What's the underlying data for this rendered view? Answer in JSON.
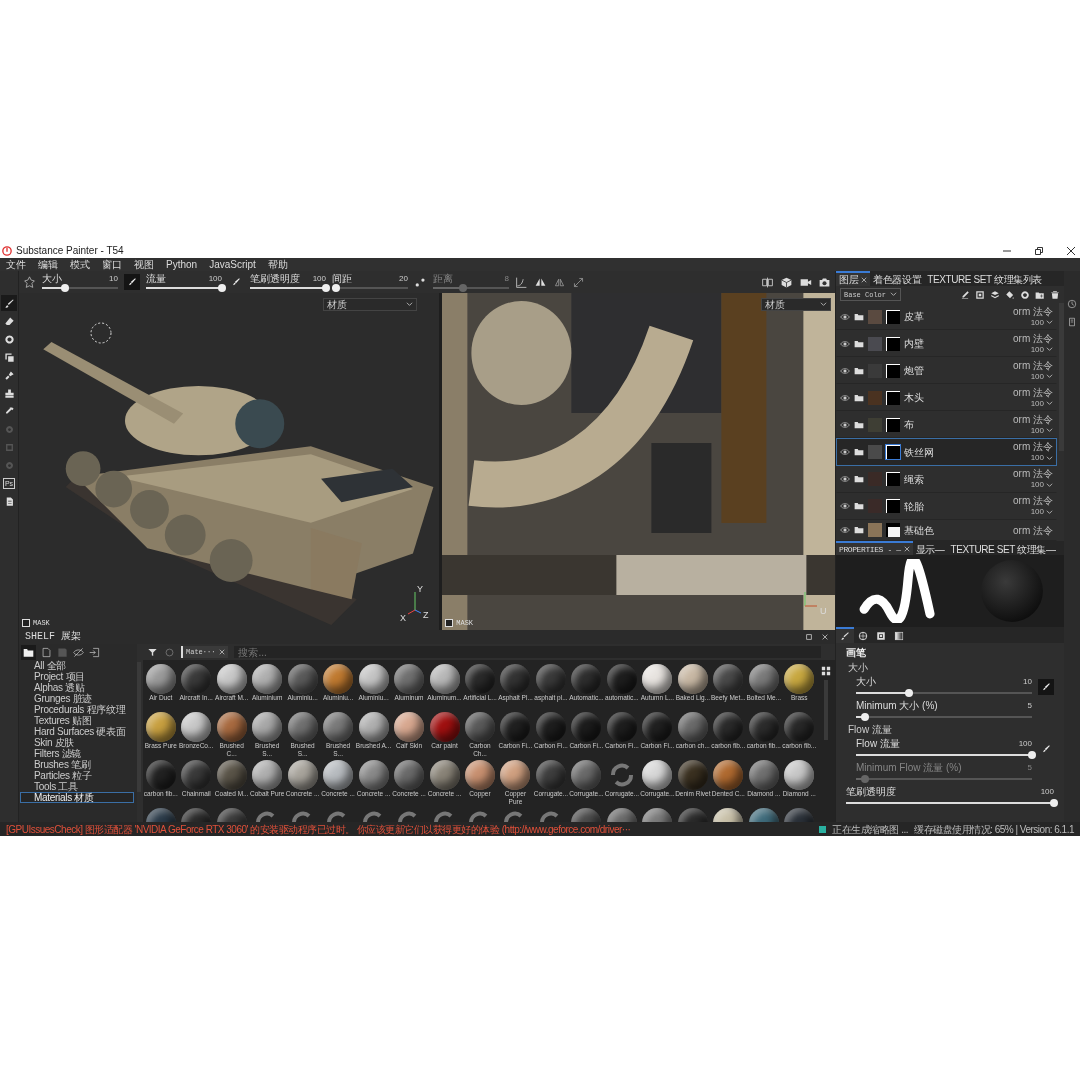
{
  "window": {
    "title": "Substance Painter - T54"
  },
  "menu": [
    "文件",
    "编辑",
    "模式",
    "窗口",
    "视图",
    "Python",
    "JavaScript",
    "帮助"
  ],
  "tools": [
    {
      "selected": true,
      "disabled": false
    },
    {
      "selected": false,
      "disabled": false
    },
    {
      "selected": false,
      "disabled": false
    },
    {
      "selected": false,
      "disabled": false
    },
    {
      "selected": false,
      "disabled": false
    },
    {
      "selected": false,
      "disabled": false
    },
    {
      "selected": false,
      "disabled": false
    },
    {
      "selected": false,
      "disabled": true
    },
    {
      "selected": false,
      "disabled": true
    },
    {
      "selected": false,
      "disabled": true
    },
    {
      "selected": false,
      "disabled": false,
      "label": "Ps"
    },
    {
      "selected": false,
      "disabled": false
    }
  ],
  "tool_options": [
    {
      "label": "大小",
      "value": "10",
      "level": 0.3,
      "disabled": false,
      "pressure_toggle": {
        "on": true
      }
    },
    {
      "label": "流量",
      "value": "100",
      "level": 1,
      "disabled": false,
      "pressure_toggle": {
        "on": false
      }
    },
    {
      "label": "笔刷透明度",
      "value": "100",
      "level": 1,
      "disabled": false
    },
    {
      "label": "间距",
      "value": "20",
      "level": 0.05,
      "disabled": false
    },
    {
      "label": "距离",
      "value": "8",
      "level": 0.4,
      "disabled": true
    }
  ],
  "viewport_3d": {
    "channel": "材质",
    "mask_label": "MASK",
    "axes": [
      "Y",
      "Z",
      "X"
    ]
  },
  "viewport_2d": {
    "channel": "材质",
    "mask_label": "MASK",
    "axis": "U"
  },
  "layers_panel": {
    "tabs": [
      {
        "label": "图层",
        "selected": true,
        "closable": true
      },
      {
        "label": "着色器设置",
        "selected": false,
        "closable": false
      },
      {
        "label": "TEXTURE SET 纹理集列表",
        "selected": false,
        "closable": false
      }
    ],
    "channel": "Base Color",
    "layers": [
      {
        "name": "皮革",
        "blend": "orm 法令",
        "opacity": "100",
        "color": "#5a4a40",
        "mask_light": false,
        "visible": true,
        "selected": false
      },
      {
        "name": "内壁",
        "blend": "orm 法令",
        "opacity": "100",
        "color": "#4a4a50",
        "mask_light": false,
        "visible": true,
        "selected": false
      },
      {
        "name": "炮管",
        "blend": "orm 法令",
        "opacity": "100",
        "color": "#3a3a3a",
        "mask_light": false,
        "visible": true,
        "selected": false
      },
      {
        "name": "木头",
        "blend": "orm 法令",
        "opacity": "100",
        "color": "#4a3220",
        "mask_light": false,
        "visible": true,
        "selected": false
      },
      {
        "name": "布",
        "blend": "orm 法令",
        "opacity": "100",
        "color": "#3e3e34",
        "mask_light": false,
        "visible": true,
        "selected": false
      },
      {
        "name": "铁丝网",
        "blend": "orm 法令",
        "opacity": "100",
        "color": "#4a4a4a",
        "mask_light": false,
        "visible": true,
        "selected": true
      },
      {
        "name": "绳索",
        "blend": "orm 法令",
        "opacity": "100",
        "color": "#3a2a26",
        "mask_light": false,
        "visible": true,
        "selected": false
      },
      {
        "name": "轮胎",
        "blend": "orm 法令",
        "opacity": "100",
        "color": "#3a2a28",
        "mask_light": false,
        "visible": true,
        "selected": false
      },
      {
        "name": "基础色",
        "blend": "orm 法令",
        "color": "#8a7458",
        "mask_light": true,
        "visible": true,
        "selected": false
      }
    ]
  },
  "properties": {
    "tabs": [
      {
        "label": "PROPERTIES - —",
        "selected": true,
        "closable": true
      },
      {
        "label": "显示—",
        "selected": false,
        "closable": false
      },
      {
        "label": "TEXTURE SET 纹理集—",
        "selected": false,
        "closable": false
      }
    ],
    "icon_tabs": [
      {
        "selected": true
      },
      {
        "selected": false
      },
      {
        "selected": false
      },
      {
        "selected": false
      }
    ],
    "section": "画笔",
    "groups": [
      {
        "title": "大小",
        "sliders": [
          {
            "label": "大小",
            "value": "10",
            "level": 0.3,
            "disabled": false,
            "pressure_toggle": {
              "on": true
            }
          },
          {
            "label": "Minimum 大小 (%)",
            "value": "5",
            "level": 0.05,
            "disabled": false
          }
        ]
      },
      {
        "title": "Flow 流量",
        "sliders": [
          {
            "label": "Flow 流量",
            "value": "100",
            "level": 1,
            "disabled": false,
            "pressure_toggle": {
              "on": false
            }
          },
          {
            "label": "Minimum Flow 流量 (%)",
            "value": "5",
            "level": 0.05,
            "disabled": true
          }
        ]
      }
    ],
    "opacity": {
      "label": "笔刷透明度",
      "value": "100",
      "level": 1
    }
  },
  "shelf": {
    "title": "SHELF 展架",
    "categories": [
      {
        "label": "All 全部",
        "selected": false
      },
      {
        "label": "Project 项目",
        "selected": false
      },
      {
        "label": "Alphas 透贴",
        "selected": false
      },
      {
        "label": "Grunges 脏迹",
        "selected": false
      },
      {
        "label": "Procedurals 程序纹理",
        "selected": false
      },
      {
        "label": "Textures 贴图",
        "selected": false
      },
      {
        "label": "Hard Surfaces 硬表面",
        "selected": false
      },
      {
        "label": "Skin 皮肤",
        "selected": false
      },
      {
        "label": "Filters 滤镜",
        "selected": false
      },
      {
        "label": "Brushes 笔刷",
        "selected": false
      },
      {
        "label": "Particles 粒子",
        "selected": false
      },
      {
        "label": "Tools 工具",
        "selected": false
      },
      {
        "label": "Materials 材质",
        "selected": true
      }
    ],
    "filter_chip": "Mate···",
    "search": {
      "placeholder": "搜索..."
    },
    "materials": [
      {
        "kind": "sphere",
        "name": "Air Duct",
        "color": "#9a9a9a"
      },
      {
        "kind": "sphere",
        "name": "Aircraft In...",
        "color": "#3a3a3a"
      },
      {
        "kind": "sphere",
        "name": "Aircraft M...",
        "color": "#c8c8c8"
      },
      {
        "kind": "sphere",
        "name": "Aluminium",
        "color": "#b0b0b0"
      },
      {
        "kind": "sphere",
        "name": "Aluminiu...",
        "color": "#5a5a5a"
      },
      {
        "kind": "sphere",
        "name": "Aluminiu...",
        "color": "#c07a30"
      },
      {
        "kind": "sphere",
        "name": "Aluminiu...",
        "color": "#c4c4c4"
      },
      {
        "kind": "sphere",
        "name": "Aluminum",
        "color": "#707070"
      },
      {
        "kind": "sphere",
        "name": "Aluminum...",
        "color": "#b8b8b8"
      },
      {
        "kind": "sphere",
        "name": "Artificial L...",
        "color": "#2a2a2a"
      },
      {
        "kind": "sphere",
        "name": "Asphalt Pl...",
        "color": "#333333"
      },
      {
        "kind": "sphere",
        "name": "asphalt pl...",
        "color": "#3a3a3a"
      },
      {
        "kind": "sphere",
        "name": "Automatic...",
        "color": "#2e2e2e"
      },
      {
        "kind": "sphere",
        "name": "automatic...",
        "color": "#1e1e1e"
      },
      {
        "kind": "sphere",
        "name": "Autumn L...",
        "color": "#e8e4e0"
      },
      {
        "kind": "sphere",
        "name": "Baked Lig...",
        "color": "#c8b8a4"
      },
      {
        "kind": "sphere",
        "name": "Beefy Met...",
        "color": "#4a4a4a"
      },
      {
        "kind": "sphere",
        "name": "Bolted Me...",
        "color": "#7a7a7a"
      },
      {
        "kind": "sphere",
        "name": "Brass",
        "color": "#c8a840"
      },
      {
        "kind": "sphere",
        "name": "Brass Pure",
        "color": "#c8a040"
      },
      {
        "kind": "sphere",
        "name": "BronzeCo...",
        "color": "#c8c8c8"
      },
      {
        "kind": "sphere",
        "name": "Brushed C...",
        "color": "#a86a40"
      },
      {
        "kind": "sphere",
        "name": "Brushed S...",
        "color": "#a8a8a8"
      },
      {
        "kind": "sphere",
        "name": "Brushed S...",
        "color": "#707070"
      },
      {
        "kind": "sphere",
        "name": "Brushed S...",
        "color": "#7a7a7a"
      },
      {
        "kind": "sphere",
        "name": "Brushed A...",
        "color": "#b0b0b0"
      },
      {
        "kind": "sphere",
        "name": "Calf Skin",
        "color": "#d8a890"
      },
      {
        "kind": "sphere",
        "name": "Car paint",
        "color": "#a01010"
      },
      {
        "kind": "sphere",
        "name": "Carbon Ch...",
        "color": "#5a5a5a"
      },
      {
        "kind": "sphere",
        "name": "Carbon Fi...",
        "color": "#202020"
      },
      {
        "kind": "sphere",
        "name": "Carbon Fi...",
        "color": "#1e1e1e"
      },
      {
        "kind": "sphere",
        "name": "Carbon Fi...",
        "color": "#1c1c1c"
      },
      {
        "kind": "sphere",
        "name": "Carbon Fi...",
        "color": "#1e1e1e"
      },
      {
        "kind": "sphere",
        "name": "Carbon Fi...",
        "color": "#202020"
      },
      {
        "kind": "sphere",
        "name": "carbon ch...",
        "color": "#6a6a6a"
      },
      {
        "kind": "sphere",
        "name": "carbon fib...",
        "color": "#2a2a2a"
      },
      {
        "kind": "sphere",
        "name": "carbon fib...",
        "color": "#2c2c2c"
      },
      {
        "kind": "sphere",
        "name": "carbon fib...",
        "color": "#282828"
      },
      {
        "kind": "sphere",
        "name": "carbon fib...",
        "color": "#222222"
      },
      {
        "kind": "sphere",
        "name": "Chainmail",
        "color": "#3a3a3a"
      },
      {
        "kind": "sphere",
        "name": "Coated M...",
        "color": "#5a5448"
      },
      {
        "kind": "sphere",
        "name": "Cobalt Pure",
        "color": "#b0b0b0"
      },
      {
        "kind": "sphere",
        "name": "Concrete ...",
        "color": "#a8a49c"
      },
      {
        "kind": "sphere",
        "name": "Concrete ...",
        "color": "#b8bcc0"
      },
      {
        "kind": "sphere",
        "name": "Concrete ...",
        "color": "#8a8a8a"
      },
      {
        "kind": "sphere",
        "name": "Concrete ...",
        "color": "#6a6a6a"
      },
      {
        "kind": "sphere",
        "name": "Concrete ...",
        "color": "#8a8478"
      },
      {
        "kind": "sphere",
        "name": "Copper",
        "color": "#c89070"
      },
      {
        "kind": "sphere",
        "name": "Copper Pure",
        "color": "#d0a080"
      },
      {
        "kind": "sphere",
        "name": "Corrugate...",
        "color": "#3e3e3e"
      },
      {
        "kind": "sphere",
        "name": "Corrugate...",
        "color": "#6a6a6a"
      },
      {
        "kind": "loading",
        "name": "Corrugate..."
      },
      {
        "kind": "sphere",
        "name": "Corrugate...",
        "color": "#d8d8d8"
      },
      {
        "kind": "sphere",
        "name": "Denim Rivet",
        "color": "#3a3020"
      },
      {
        "kind": "sphere",
        "name": "Dented C...",
        "color": "#b06a30"
      },
      {
        "kind": "sphere",
        "name": "Diamond ...",
        "color": "#707070"
      },
      {
        "kind": "sphere",
        "name": "Diamond ...",
        "color": "#c8c8c8"
      }
    ],
    "partial_row": [
      {
        "kind": "sphere",
        "color": "#2a3a48"
      },
      {
        "kind": "sphere",
        "color": "#2a2a2a"
      },
      {
        "kind": "sphere",
        "color": "#3a3a3a"
      },
      {
        "kind": "loading"
      },
      {
        "kind": "loading"
      },
      {
        "kind": "loading"
      },
      {
        "kind": "loading"
      },
      {
        "kind": "loading"
      },
      {
        "kind": "loading"
      },
      {
        "kind": "loading"
      },
      {
        "kind": "loading"
      },
      {
        "kind": "loading"
      },
      {
        "kind": "sphere",
        "color": "#4a4a4a"
      },
      {
        "kind": "sphere",
        "color": "#6a6a6a"
      },
      {
        "kind": "sphere",
        "color": "#7a7a7a"
      },
      {
        "kind": "sphere",
        "color": "#2a2a2a"
      },
      {
        "kind": "sphere",
        "color": "#c8c0a8"
      },
      {
        "kind": "sphere",
        "color": "#3e6a7a"
      },
      {
        "kind": "sphere",
        "color": "#2a3038"
      }
    ]
  },
  "status_bar": {
    "message": "[GPUIssuesCheck] 图形适配器 'NVIDIA GeForce RTX 3060' 的安装驱动程序已过时。 你应该更新它们以获得更好的体验 (http://www.geforce.com/driver···",
    "task": "正在生成缩略图 ...",
    "info": "缓存磁盘使用情况:  65% | Version: 6.1.1"
  }
}
